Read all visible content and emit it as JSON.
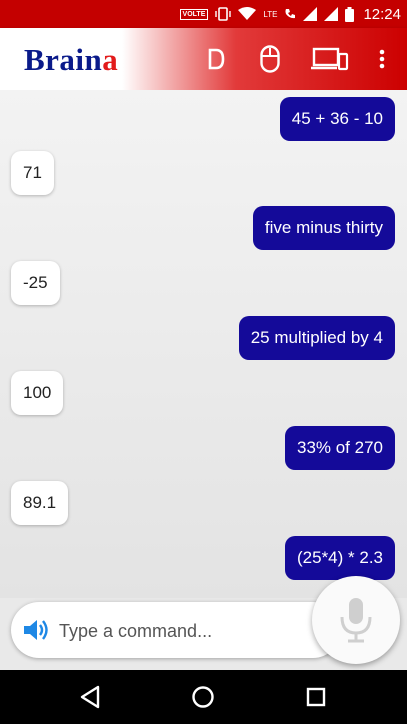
{
  "status_bar": {
    "volte": "VOLTE",
    "lte": "LTE",
    "time": "12:24",
    "icons": [
      "vibrate-icon",
      "wifi-icon",
      "call-icon",
      "signal-icon",
      "signal-icon",
      "battery-icon"
    ]
  },
  "app": {
    "brand_main": "Brain",
    "brand_accent": "a",
    "toolbar_icons": [
      "d-icon",
      "mouse-icon",
      "devices-icon",
      "more-vert-icon"
    ]
  },
  "messages": [
    {
      "from": "user",
      "text": "45 + 36 - 10"
    },
    {
      "from": "bot",
      "text": "71"
    },
    {
      "from": "user",
      "text": "five minus thirty"
    },
    {
      "from": "bot",
      "text": "-25"
    },
    {
      "from": "user",
      "text": "25 multiplied by 4"
    },
    {
      "from": "bot",
      "text": "100"
    },
    {
      "from": "user",
      "text": "33% of 270"
    },
    {
      "from": "bot",
      "text": "89.1"
    },
    {
      "from": "user",
      "text": "(25*4) * 2.3"
    }
  ],
  "input": {
    "placeholder": "Type a command..."
  },
  "nav": {
    "icons": [
      "back-icon",
      "home-icon",
      "recents-icon"
    ]
  },
  "colors": {
    "status_bar": "#c40000",
    "app_bar_end": "#cc0000",
    "brand_blue": "#0a1a8a",
    "brand_red": "#e21b1b",
    "user_bubble": "#140a99",
    "input_icon": "#1e88e5"
  }
}
